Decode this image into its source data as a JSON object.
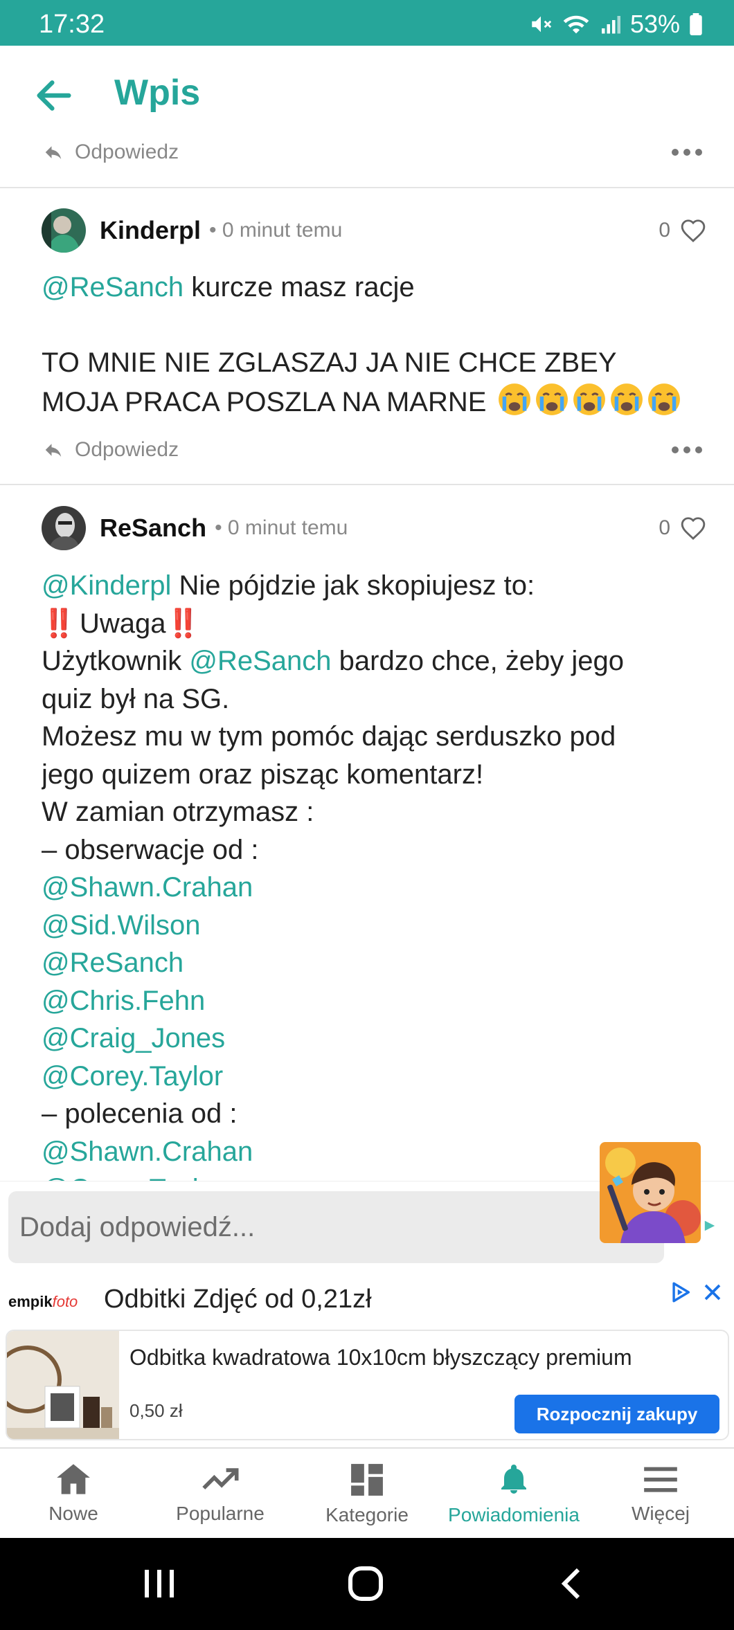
{
  "status": {
    "time": "17:32",
    "battery": "53%"
  },
  "header": {
    "title": "Wpis"
  },
  "top_reply": {
    "reply_label": "Odpowiedz"
  },
  "comments": [
    {
      "author": "Kinderpl",
      "time": "• 0 minut temu",
      "likes": "0",
      "mention": "@ReSanch",
      "line1": " kurcze masz racje",
      "line2": "TO MNIE NIE ZGLASZAJ JA NIE CHCE ZBEY",
      "line3": "MOJA PRACA POSZLA NA MARNE",
      "reply_label": "Odpowiedz"
    },
    {
      "author": "ReSanch",
      "time": "• 0 minut temu",
      "likes": "0",
      "l1_mention": "@Kinderpl",
      "l1_text": " Nie pójdzie jak skopiujesz to:",
      "l2_excl": "‼️",
      "l2_text": "Uwaga",
      "l3_a": "Użytkownik ",
      "l3_mention": "@ReSanch",
      "l3_b": " bardzo chce, żeby jego",
      "l4": "quiz był na SG.",
      "l5": "Możesz mu w tym pomóc dając serduszko pod",
      "l6": "jego quizem oraz pisząc komentarz!",
      "l7": "W zamian otrzymasz :",
      "l8": "– obserwacje od :",
      "m1": "@Shawn.Crahan",
      "m2": "@Sid.Wilson",
      "m3": "@ReSanch",
      "m4": "@Chris.Fehn",
      "m5": "@Craig_Jones",
      "m6": "@Corey.Taylor",
      "l15": "– polecenia od :",
      "m7": "@Shawn.Crahan",
      "m8": "@Corey.Taylor"
    }
  ],
  "reply_box": {
    "placeholder": "Dodaj odpowiedź..."
  },
  "ad": {
    "brand_left": "empik",
    "brand_right": "foto",
    "headline": "Odbitki Zdjęć od 0,21zł",
    "product": "Odbitka kwadratowa 10x10cm błyszczący premium",
    "price": "0,50 zł",
    "cta": "Rozpocznij zakupy"
  },
  "bottom_nav": [
    {
      "label": "Nowe",
      "icon": "home-icon"
    },
    {
      "label": "Popularne",
      "icon": "trending-icon"
    },
    {
      "label": "Kategorie",
      "icon": "grid-icon"
    },
    {
      "label": "Powiadomienia",
      "icon": "bell-icon",
      "active": true
    },
    {
      "label": "Więcej",
      "icon": "menu-icon"
    }
  ],
  "colors": {
    "accent": "#26a69a",
    "cta": "#1a73e8",
    "text": "#222222"
  }
}
